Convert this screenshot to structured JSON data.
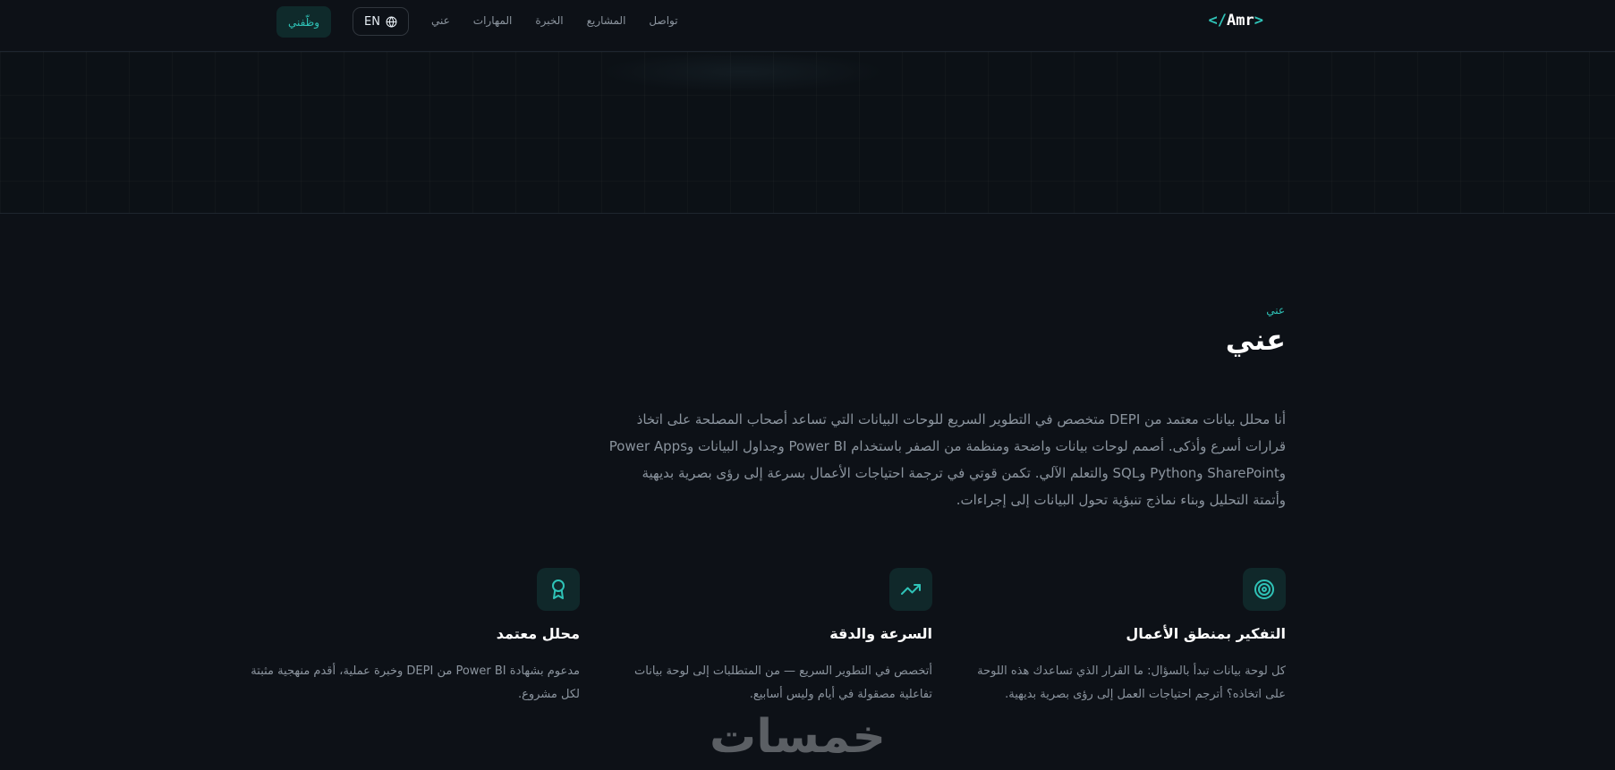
{
  "nav": {
    "logo": {
      "open": "</",
      "name": "Amr",
      "close": ">"
    },
    "links": [
      "عني",
      "المهارات",
      "الخبرة",
      "المشاريع",
      "تواصل"
    ],
    "lang_label": "EN",
    "hire_label": "وظّفني"
  },
  "about": {
    "eyebrow": "عني",
    "title": "عني",
    "text": "أنا محلل بيانات معتمد من DEPI متخصص في التطوير السريع للوحات البيانات التي تساعد أصحاب المصلحة على اتخاذ قرارات أسرع وأذكى. أصمم لوحات بيانات واضحة ومنظمة من الصفر باستخدام Power BI وجداول البيانات وPower Apps وSharePoint وPython وSQL والتعلم الآلي. تكمن قوتي في ترجمة احتياجات الأعمال بسرعة إلى رؤى بصرية بديهية وأتمتة التحليل وبناء نماذج تنبؤية تحول البيانات إلى إجراءات."
  },
  "cards": [
    {
      "icon": "target-icon",
      "title": "التفكير بمنطق الأعمال",
      "desc": "كل لوحة بيانات تبدأ بالسؤال: ما القرار الذي تساعدك هذه اللوحة على اتخاذه؟ أترجم احتياجات العمل إلى رؤى بصرية بديهية."
    },
    {
      "icon": "trending-up-icon",
      "title": "السرعة والدقة",
      "desc": "أتخصص في التطوير السريع — من المتطلبات إلى لوحة بيانات تفاعلية مصقولة في أيام وليس أسابيع."
    },
    {
      "icon": "award-icon",
      "title": "محلل معتمد",
      "desc": "مدعوم بشهادة Power BI من DEPI وخبرة عملية، أقدم منهجية مثبتة لكل مشروع."
    }
  ],
  "watermark": "خمسات",
  "colors": {
    "accent": "#2fc3b7",
    "background": "#0d1117",
    "muted_text": "#8b949e"
  }
}
